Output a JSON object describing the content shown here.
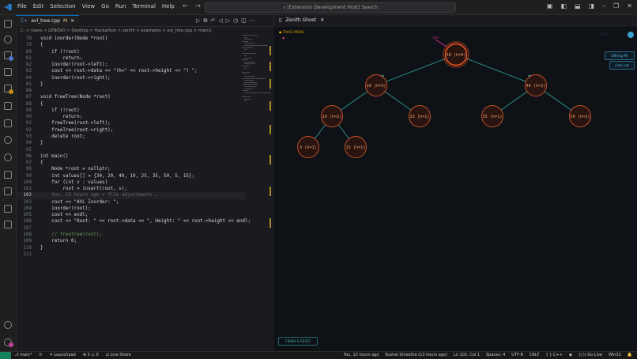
{
  "menu": [
    "File",
    "Edit",
    "Selection",
    "View",
    "Go",
    "Run",
    "Terminal",
    "Help"
  ],
  "search": {
    "placeholder": "[Extension Development Host] Search"
  },
  "tab": {
    "name": "avl_tree.cpp",
    "modified": "M"
  },
  "breadcrumb": "C: > Users > LENOVO > Desktop > Hackathon > zenith > examples > avl_tree.cpp > main()",
  "code": [
    {
      "n": "78",
      "t": "void inorder(Node *root)"
    },
    {
      "n": "79",
      "t": "{"
    },
    {
      "n": "80",
      "t": "    if (!root)"
    },
    {
      "n": "81",
      "t": "        return;"
    },
    {
      "n": "82",
      "t": "    inorder(root->left);"
    },
    {
      "n": "83",
      "t": "    cout << root->data << \"(h=\" << root->height << \") \";"
    },
    {
      "n": "84",
      "t": "    inorder(root->right);"
    },
    {
      "n": "85",
      "t": "}"
    },
    {
      "n": "86",
      "t": ""
    },
    {
      "n": "87",
      "t": "void freeTree(Node *root)"
    },
    {
      "n": "88",
      "t": "{"
    },
    {
      "n": "89",
      "t": "    if (!root)"
    },
    {
      "n": "90",
      "t": "        return;"
    },
    {
      "n": "91",
      "t": "    freeTree(root->left);"
    },
    {
      "n": "92",
      "t": "    freeTree(root->right);"
    },
    {
      "n": "93",
      "t": "    delete root;"
    },
    {
      "n": "94",
      "t": "}"
    },
    {
      "n": "95",
      "t": ""
    },
    {
      "n": "96",
      "t": "int main()"
    },
    {
      "n": "97",
      "t": "{"
    },
    {
      "n": "98",
      "t": "    Node *root = nullptr;"
    },
    {
      "n": "99",
      "t": "    int values[] = {30, 20, 40, 10, 25, 35, 50, 5, 15};"
    },
    {
      "n": "100",
      "t": "    for (int v : values)"
    },
    {
      "n": "101",
      "t": "        root = insert(root, v);"
    },
    {
      "n": "102",
      "t": "    You, 13 hours ago • file adjustments …"
    },
    {
      "n": "103",
      "t": "    cout << \"AVL Inorder: \";"
    },
    {
      "n": "104",
      "t": "    inorder(root);"
    },
    {
      "n": "105",
      "t": "    cout << endl;"
    },
    {
      "n": "106",
      "t": "    cout << \"Root: \" << root->data << \", Height: \" << root->height << endl;"
    },
    {
      "n": "107",
      "t": ""
    },
    {
      "n": "108",
      "t": "    // freeTree(root);"
    },
    {
      "n": "109",
      "t": "    return 0;"
    },
    {
      "n": "110",
      "t": "}"
    },
    {
      "n": "111",
      "t": ""
    }
  ],
  "panel": {
    "title": "Zenith Ghost",
    "trace_label": "TRACE MODE",
    "buttons": [
      "DIN log M)",
      "clear out"
    ],
    "finish_button": "FINISH & RESET",
    "root_label": "root"
  },
  "tree": {
    "nodes": [
      {
        "id": "n30",
        "label": "30 (h=4)",
        "level": 0,
        "order": 0
      },
      {
        "id": "n20",
        "label": "20 (h=3)",
        "level": 1,
        "order": 0
      },
      {
        "id": "n40",
        "label": "40 (h=2)",
        "level": 1,
        "order": 1
      },
      {
        "id": "n10",
        "label": "10 (h=2)",
        "level": 2,
        "order": 0
      },
      {
        "id": "n25",
        "label": "25 (h=1)",
        "level": 2,
        "order": 1
      },
      {
        "id": "n35",
        "label": "35 (h=1)",
        "level": 2,
        "order": 2
      },
      {
        "id": "n50",
        "label": "50 (h=1)",
        "level": 2,
        "order": 3
      },
      {
        "id": "n5",
        "label": "5 (h=1)",
        "level": 3,
        "order": 0
      },
      {
        "id": "n15",
        "label": "15 (h=1)",
        "level": 3,
        "order": 1
      }
    ],
    "edges": [
      [
        "n30",
        "n20"
      ],
      [
        "n30",
        "n40"
      ],
      [
        "n20",
        "n10"
      ],
      [
        "n20",
        "n25"
      ],
      [
        "n40",
        "n35"
      ],
      [
        "n40",
        "n50"
      ],
      [
        "n10",
        "n5"
      ],
      [
        "n10",
        "n15"
      ]
    ],
    "highlighted": "n30",
    "colors": {
      "node_stroke": "#c0502a",
      "node_fill": "#2a1410",
      "highlight": "#ff5a1f",
      "edge": "#2fa89a",
      "text": "#e8a070"
    }
  },
  "status": {
    "branch": "main*",
    "launchpad": "Launchpad",
    "problems": "0 ⚠ 0",
    "live_share": "Live Share",
    "blame": "You, 13 hours ago",
    "author": "Kushal Shrestha (13 hours ago)",
    "position": "Ln 102, Col 1",
    "spaces": "Spaces: 4",
    "encoding": "UTF-8",
    "eol": "CRLF",
    "language": "{ } C++",
    "go_live": "Go Live",
    "platform": "Win32"
  }
}
